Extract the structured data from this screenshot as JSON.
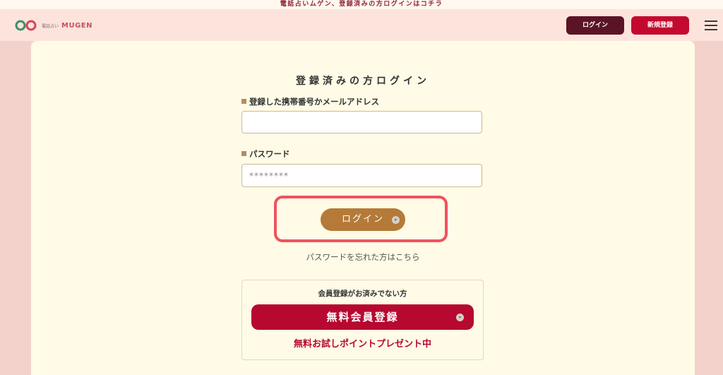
{
  "top_banner": {
    "text": "電話占いムゲン、登録済みの方ログインはコチラ"
  },
  "header": {
    "logo_sub": "電話占い",
    "logo_text": "MUGEN",
    "login_label": "ログイン",
    "register_label": "新規登録"
  },
  "form": {
    "title": "登録済みの方ログイン",
    "phone_email_label": "登録した携帯番号かメールアドレス",
    "phone_email_value": "",
    "password_label": "パスワード",
    "password_placeholder": "********",
    "login_button": "ログイン",
    "forgot_link": "パスワードを忘れた方はこちら"
  },
  "registration": {
    "title": "会員登録がお済みでない方",
    "button": "無料会員登録",
    "promo": "無料お試しポイントプレゼント中"
  },
  "colors": {
    "page_bg": "#f3d2cb",
    "panel_bg": "#fffbe7",
    "login_button": "#b57a38",
    "register_red": "#b70830",
    "highlight": "#f0525e",
    "header_login": "#5a1426"
  }
}
